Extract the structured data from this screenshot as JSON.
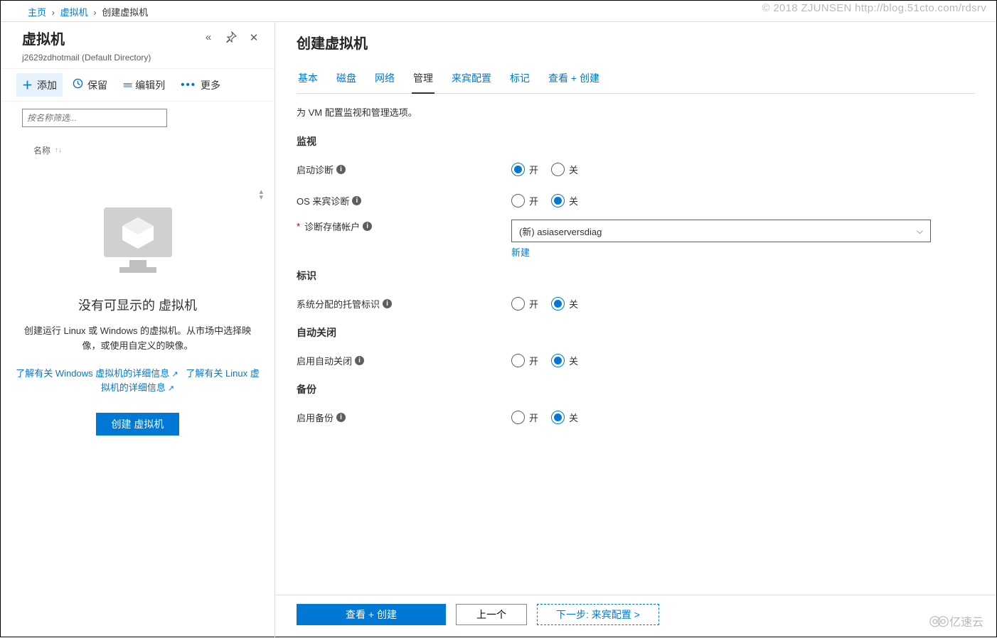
{
  "watermark": "© 2018 ZJUNSEN http://blog.51cto.com/rdsrv",
  "logo_wm": "亿速云",
  "breadcrumb": {
    "home": "主页",
    "vm": "虚拟机",
    "create": "创建虚拟机"
  },
  "left": {
    "title": "虚拟机",
    "subtitle": "j2629zdhotmail (Default Directory)",
    "toolbar": {
      "add": "添加",
      "keep": "保留",
      "editcols": "编辑列",
      "more": "更多"
    },
    "filter_placeholder": "按名称筛选...",
    "col_name": "名称",
    "empty_title": "没有可显示的 虚拟机",
    "empty_desc": "创建运行 Linux 或 Windows 的虚拟机。从市场中选择映像，或使用自定义的映像。",
    "link_win": "了解有关 Windows 虚拟机的详细信息",
    "link_linux": "了解有关 Linux 虚拟机的详细信息",
    "create_btn": "创建 虚拟机"
  },
  "right": {
    "title": "创建虚拟机",
    "tabs": {
      "basic": "基本",
      "disk": "磁盘",
      "network": "网络",
      "manage": "管理",
      "guest": "来宾配置",
      "tags": "标记",
      "review": "查看 + 创建"
    },
    "active_tab": "manage",
    "tab_desc": "为 VM 配置监视和管理选项。",
    "radio_on": "开",
    "radio_off": "关",
    "sections": {
      "monitor": {
        "heading": "监视",
        "boot_diag": "启动诊断",
        "os_diag": "OS 来宾诊断",
        "storage": "诊断存储帐户",
        "storage_value": "(新) asiaserversdiag",
        "new_link": "新建"
      },
      "identity": {
        "heading": "标识",
        "managed": "系统分配的托管标识"
      },
      "autoshutdown": {
        "heading": "自动关闭",
        "enable": "启用自动关闭"
      },
      "backup": {
        "heading": "备份",
        "enable": "启用备份"
      }
    },
    "footer": {
      "review": "查看 + 创建",
      "prev": "上一个",
      "next": "下一步: 来宾配置 >"
    }
  }
}
